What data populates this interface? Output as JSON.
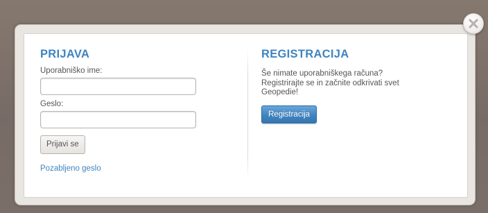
{
  "login": {
    "heading": "PRIJAVA",
    "username_label": "Uporabniško ime:",
    "username_value": "",
    "password_label": "Geslo:",
    "password_value": "",
    "submit_label": "Prijavi se",
    "forgot_link": "Pozabljeno geslo"
  },
  "registration": {
    "heading": "REGISTRACIJA",
    "description": "Še nimate uporabniškega računa? Registrirajte se in začnite odkrivati svet Geopedie!",
    "button_label": "Registracija"
  },
  "icons": {
    "close": "close-icon"
  },
  "colors": {
    "accent": "#3f84c0",
    "text": "#555555",
    "backdrop": "#7d716c"
  }
}
